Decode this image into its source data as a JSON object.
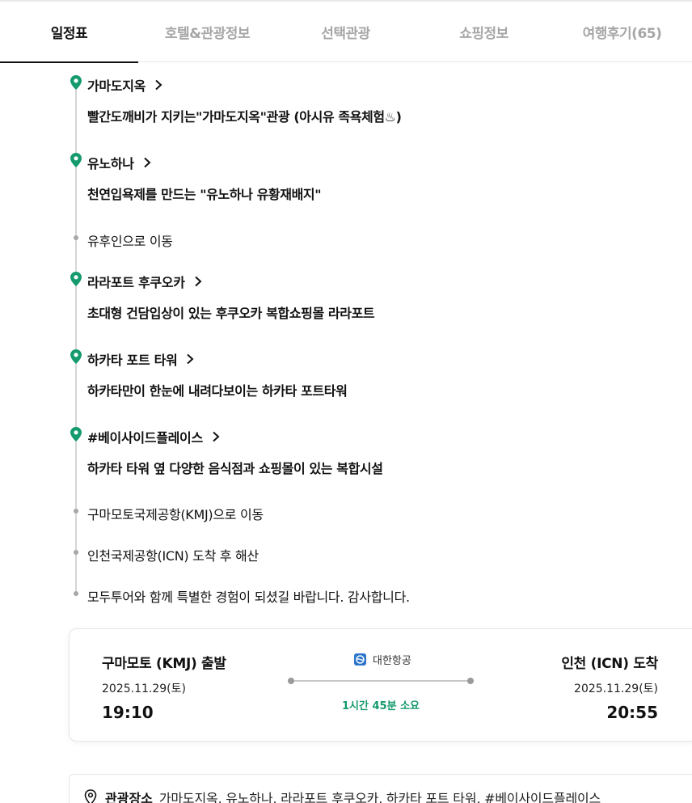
{
  "tabs": [
    {
      "label": "일정표",
      "active": true
    },
    {
      "label": "호텔&관광정보",
      "active": false
    },
    {
      "label": "선택관광",
      "active": false
    },
    {
      "label": "쇼핑정보",
      "active": false
    },
    {
      "label": "여행후기(65)",
      "active": false
    }
  ],
  "timeline": {
    "items": [
      {
        "type": "place",
        "title": "가마도지옥",
        "desc": "빨간도깨비가 지키는\"가마도지옥\"관광 (아시유 족욕체험♨)"
      },
      {
        "type": "place",
        "title": "유노하나",
        "desc": "천연입욕제를 만드는 \"유노하나 유황재배지\""
      },
      {
        "type": "move",
        "text": "유후인으로 이동"
      },
      {
        "type": "place",
        "title": "라라포트 후쿠오카",
        "desc": "초대형 건담입상이 있는 후쿠오카 복합쇼핑몰 라라포트"
      },
      {
        "type": "place",
        "title": "하카타 포트 타워",
        "desc": "하카타만이 한눈에 내려다보이는 하카타 포트타워"
      },
      {
        "type": "place",
        "title": "#베이사이드플레이스",
        "desc": "하카타 타워 옆 다양한 음식점과 쇼핑몰이 있는 복합시설"
      },
      {
        "type": "move",
        "text": "구마모토국제공항(KMJ)으로 이동"
      },
      {
        "type": "move",
        "text": "인천국제공항(ICN) 도착 후 해산"
      },
      {
        "type": "move",
        "text": "모두투어와 함께 특별한 경험이 되셨길 바랍니다. 감사합니다."
      }
    ]
  },
  "flight": {
    "departure": {
      "city": "구마모토 (KMJ) 출발",
      "date": "2025.11.29(토)",
      "time": "19:10"
    },
    "arrival": {
      "city": "인천 (ICN) 도착",
      "date": "2025.11.29(토)",
      "time": "20:55"
    },
    "airline": "대한항공",
    "duration": "1시간 45분 소요"
  },
  "info": {
    "label": "관광장소",
    "value": "가마도지옥, 유노하나, 라라포트 후쿠오카, 하카타 포트 타워, #베이사이드플레이스"
  },
  "colors": {
    "pin": "#159a6e",
    "duration": "#159a6e",
    "active_tab": "#111111",
    "inactive_tab": "#a6a6a6",
    "airline_logo": "#2a74c9"
  },
  "icons": {
    "place_marker": "location-pin-icon",
    "move_marker": "dot-icon",
    "chevron": "chevron-right-icon",
    "airline": "korean-air-logo-icon",
    "info": "location-outline-icon"
  }
}
